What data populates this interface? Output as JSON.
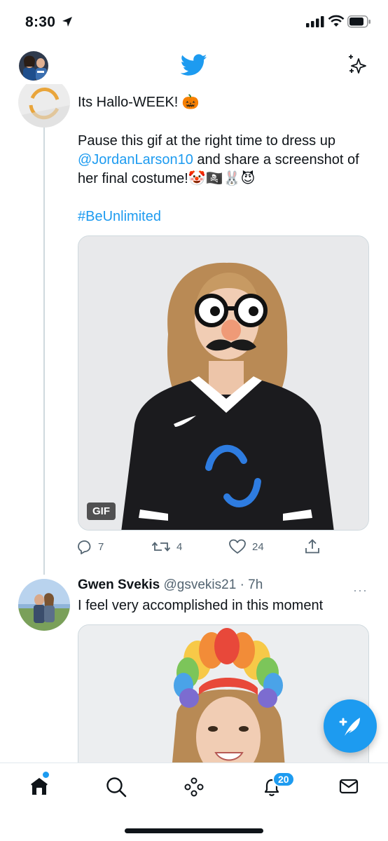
{
  "status": {
    "time": "8:30"
  },
  "nav": {
    "logo_icon": "twitter-bird-icon",
    "sparkle_icon": "sparkle-icon"
  },
  "tweet1": {
    "line1": "Its Hallo-WEEK! 🎃",
    "body_pre": "Pause this gif at the right time to dress up ",
    "mention": "@JordanLarson10",
    "body_post": " and share a screenshot of her final costume!🤡🏴‍☠️🐰😈",
    "hashtag": "#BeUnlimited",
    "media_badge": "GIF",
    "replies": "7",
    "retweets": "4",
    "likes": "24"
  },
  "tweet2": {
    "name": "Gwen Svekis",
    "handle": "@gsvekis21 · 7h",
    "more": "···",
    "text": "I feel very accomplished in this moment"
  },
  "tabbar": {
    "items": [
      "home-icon",
      "search-icon",
      "spaces-icon",
      "notifications-icon",
      "messages-icon"
    ],
    "notifications_badge": "20"
  },
  "colors": {
    "accent": "#1d9bf0",
    "text": "#0f1419",
    "muted": "#536471"
  }
}
